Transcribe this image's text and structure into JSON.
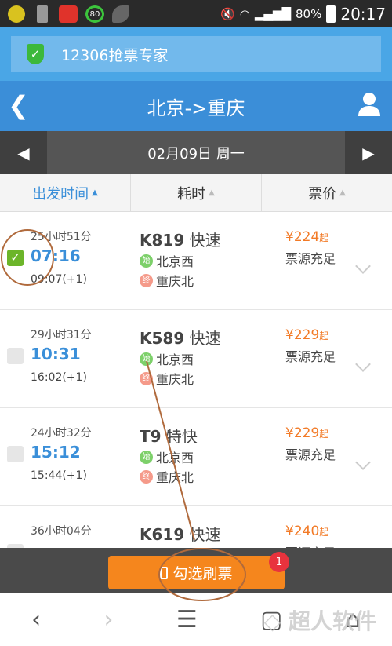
{
  "status_bar": {
    "battery": "80%",
    "time": "20:17",
    "badge_number": "80"
  },
  "banner": {
    "title": "12306抢票专家",
    "icon": "shield-check-icon"
  },
  "header": {
    "title": "北京->重庆",
    "back_icon": "chevron-left-icon",
    "user_icon": "user-icon"
  },
  "date_bar": {
    "date": "02月09日 周一"
  },
  "sort": [
    {
      "label": "出发时间",
      "active": true
    },
    {
      "label": "耗时"
    },
    {
      "label": "票价"
    }
  ],
  "trains": [
    {
      "duration": "25小时51分",
      "depart": "07:16",
      "arrive": "09:07(+1)",
      "number": "K819",
      "type": "快速",
      "from_badge": "始",
      "from": "北京西",
      "to_badge": "终",
      "to": "重庆北",
      "price": "¥224",
      "price_suffix": "起",
      "availability": "票源充足",
      "checked": true
    },
    {
      "duration": "29小时31分",
      "depart": "10:31",
      "arrive": "16:02(+1)",
      "number": "K589",
      "type": "快速",
      "from_badge": "始",
      "from": "北京西",
      "to_badge": "终",
      "to": "重庆北",
      "price": "¥229",
      "price_suffix": "起",
      "availability": "票源充足",
      "checked": false
    },
    {
      "duration": "24小时32分",
      "depart": "15:12",
      "arrive": "15:44(+1)",
      "number": "T9",
      "type": "特快",
      "from_badge": "始",
      "from": "北京西",
      "to_badge": "终",
      "to": "重庆北",
      "price": "¥229",
      "price_suffix": "起",
      "availability": "票源充足",
      "checked": false
    },
    {
      "duration": "36小时04分",
      "depart": "",
      "arrive": "",
      "number": "K619",
      "type": "快速",
      "price": "¥240",
      "price_suffix": "起",
      "availability": "票源充足",
      "checked": false
    }
  ],
  "action": {
    "label": "勾选刷票",
    "count": "1"
  },
  "watermark": "超人软件",
  "colors": {
    "accent": "#3a8fd9",
    "orange": "#f5861d",
    "price": "#f27a26",
    "check": "#6cb52a"
  }
}
